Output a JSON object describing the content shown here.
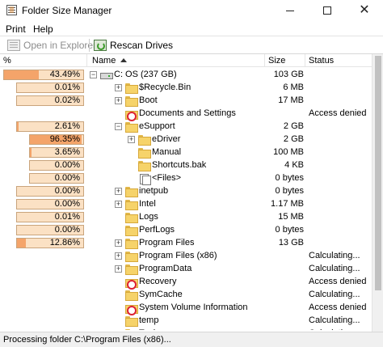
{
  "window": {
    "title": "Folder Size Manager"
  },
  "menu": {
    "items": [
      "Print",
      "Help"
    ]
  },
  "toolbar": {
    "open_label": "Open in Explorer",
    "rescan_label": "Rescan Drives"
  },
  "columns": {
    "pct": "%",
    "name": "Name",
    "size": "Size",
    "status": "Status"
  },
  "colors": {
    "bar_bg": "#fbe1c4",
    "bar_fill": "#f4a46a",
    "bar_border": "#c9a47c",
    "folder": "#f6d36a"
  },
  "rows": [
    {
      "pct": "43.49%",
      "fraction": 0.4349,
      "expander": "minus",
      "icon": "drive",
      "name": "C: OS (237 GB)",
      "size": "103 GB",
      "status": ""
    },
    {
      "pct": "0.01%",
      "fraction": 0.0001,
      "expander": "plus",
      "icon": "folder",
      "name": "$Recycle.Bin",
      "size": "6 MB",
      "status": ""
    },
    {
      "pct": "0.02%",
      "fraction": 0.0002,
      "expander": "plus",
      "icon": "folder",
      "name": "Boot",
      "size": "17 MB",
      "status": ""
    },
    {
      "pct": "",
      "fraction": 0,
      "expander": "",
      "icon": "denied",
      "name": "Documents and Settings",
      "size": "",
      "status": "Access denied"
    },
    {
      "pct": "2.61%",
      "fraction": 0.0261,
      "expander": "minus",
      "icon": "folder",
      "name": "eSupport",
      "size": "2 GB",
      "status": ""
    },
    {
      "pct": "96.35%",
      "fraction": 0.9635,
      "expander": "plus",
      "icon": "folder",
      "name": "eDriver",
      "size": "2 GB",
      "status": ""
    },
    {
      "pct": "3.65%",
      "fraction": 0.0365,
      "expander": "",
      "icon": "folder",
      "name": "Manual",
      "size": "100 MB",
      "status": ""
    },
    {
      "pct": "0.00%",
      "fraction": 0,
      "expander": "",
      "icon": "folder",
      "name": "Shortcuts.bak",
      "size": "4 KB",
      "status": ""
    },
    {
      "pct": "0.00%",
      "fraction": 0,
      "expander": "",
      "icon": "files",
      "name": "<Files>",
      "size": "0 bytes",
      "status": ""
    },
    {
      "pct": "0.00%",
      "fraction": 0,
      "expander": "plus",
      "icon": "folder",
      "name": "inetpub",
      "size": "0 bytes",
      "status": ""
    },
    {
      "pct": "0.00%",
      "fraction": 0,
      "expander": "plus",
      "icon": "folder",
      "name": "Intel",
      "size": "1.17 MB",
      "status": ""
    },
    {
      "pct": "0.01%",
      "fraction": 0.0001,
      "expander": "",
      "icon": "folder",
      "name": "Logs",
      "size": "15 MB",
      "status": ""
    },
    {
      "pct": "0.00%",
      "fraction": 0,
      "expander": "",
      "icon": "folder",
      "name": "PerfLogs",
      "size": "0 bytes",
      "status": ""
    },
    {
      "pct": "12.86%",
      "fraction": 0.1286,
      "expander": "plus",
      "icon": "folder",
      "name": "Program Files",
      "size": "13 GB",
      "status": ""
    },
    {
      "pct": "",
      "fraction": 0,
      "expander": "plus",
      "icon": "folder",
      "name": "Program Files (x86)",
      "size": "",
      "status": "Calculating..."
    },
    {
      "pct": "",
      "fraction": 0,
      "expander": "plus",
      "icon": "folder",
      "name": "ProgramData",
      "size": "",
      "status": "Calculating..."
    },
    {
      "pct": "",
      "fraction": 0,
      "expander": "",
      "icon": "denied",
      "name": "Recovery",
      "size": "",
      "status": "Access denied"
    },
    {
      "pct": "",
      "fraction": 0,
      "expander": "",
      "icon": "folder",
      "name": "SymCache",
      "size": "",
      "status": "Calculating..."
    },
    {
      "pct": "",
      "fraction": 0,
      "expander": "",
      "icon": "denied",
      "name": "System Volume Information",
      "size": "",
      "status": "Access denied"
    },
    {
      "pct": "",
      "fraction": 0,
      "expander": "",
      "icon": "folder",
      "name": "temp",
      "size": "",
      "status": "Calculating..."
    },
    {
      "pct": "",
      "fraction": 0,
      "expander": "plus",
      "icon": "folder",
      "name": "Tools",
      "size": "",
      "status": "Calculating..."
    }
  ],
  "statusbar": {
    "text": "Processing folder C:\\Program Files (x86)..."
  }
}
